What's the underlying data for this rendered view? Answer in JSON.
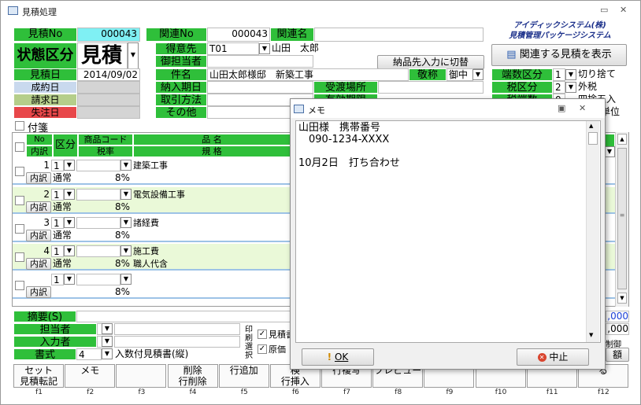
{
  "window": {
    "title": "見積処理",
    "minimize": "▭",
    "close": "✕"
  },
  "company": {
    "line1": "アイディックシステム(株)",
    "line2": "見積管理パッケージシステム"
  },
  "header": {
    "mitsumori_no_label": "見積No",
    "mitsumori_no": "000043",
    "kanren_no_label": "関連No",
    "kanren_no": "000043",
    "kanren_mei_label": "関連名"
  },
  "status": {
    "label": "状態区分",
    "value": "見積"
  },
  "dates": {
    "mitsumori_label": "見積日",
    "mitsumori_value": "2014/09/02",
    "seiyaku_label": "成約日",
    "seikyu_label": "請求日",
    "shitchu_label": "失注日"
  },
  "customer": {
    "tokuisaki_label": "得意先",
    "tokuisaki_code": "T01",
    "tokuisaki_name": "山田　太郎",
    "tantosha_label": "御担当者",
    "kenmei_label": "件名",
    "kenmei": "山田太郎様邸　新築工事",
    "keisho_label": "敬称",
    "keisho": "御中",
    "nonyu_label": "納入期日",
    "uketori_label": "受渡場所",
    "torihiki_label": "取引方法",
    "sonota_label": "その他",
    "hidden_label": "有効期限"
  },
  "buttons": {
    "nohin": "納品先入力に切替",
    "kanren_show": "関連する見積を表示"
  },
  "right_panel": {
    "hasu_label": "端数区分",
    "hasu_code": "1",
    "hasu_value": "切り捨て",
    "zei_label": "税区分",
    "zei_code": "2",
    "zei_value": "外税",
    "zei_hasu_label": "税端数",
    "zei_hasu_code": "0",
    "zei_hasu_value": "四捨五入",
    "tani_value": "単位"
  },
  "fusen": {
    "label": "付箋"
  },
  "grid": {
    "h_no": "No",
    "h_kubun": "区分",
    "h_code": "商品コード",
    "h_hinmei": "品 名",
    "h_uchiwake": "内訳",
    "h_zeiritsu": "税率",
    "h_kikaku": "規 格",
    "rows": [
      {
        "no": "1",
        "kubun": "1",
        "name": "建築工事",
        "uchiwake": "内訳",
        "tsujo": "通常",
        "rate": "8%",
        "kikaku": ""
      },
      {
        "no": "2",
        "kubun": "1",
        "name": "電気設備工事",
        "uchiwake": "内訳",
        "tsujo": "通常",
        "rate": "8%",
        "kikaku": ""
      },
      {
        "no": "3",
        "kubun": "1",
        "name": "諸経費",
        "uchiwake": "内訳",
        "tsujo": "通常",
        "rate": "8%",
        "kikaku": ""
      },
      {
        "no": "4",
        "kubun": "1",
        "name": "施工費",
        "uchiwake": "内訳",
        "tsujo": "通常",
        "rate": "8%",
        "kikaku": "職人代含"
      },
      {
        "no": "",
        "kubun": "1",
        "name": "",
        "uchiwake": "内訳",
        "tsujo": "",
        "rate": "8%",
        "kikaku": ""
      }
    ]
  },
  "bottom": {
    "tekiyo_label": "摘要(S)",
    "tanto_label": "担当者",
    "nyuryoku_label": "入力者",
    "shoshiki_label": "書式",
    "shoshiki_code": "4",
    "shoshiki_value": "入数付見積書(縦)",
    "insatsu_label": "印刷選択",
    "opt1": "見積書",
    "opt2": "原価",
    "val1": ",000",
    "val2": ",000",
    "seigyo": "制御",
    "gaku": "額"
  },
  "fkeys": [
    {
      "top": "セット",
      "bottom": "見積転記",
      "num": "f1"
    },
    {
      "top": "",
      "bottom": "メモ",
      "num": "f2"
    },
    {
      "top": "",
      "bottom": "",
      "num": "f3"
    },
    {
      "top": "削除",
      "bottom": "行削除",
      "num": "f4"
    },
    {
      "top": "",
      "bottom": "行追加",
      "num": "f5"
    },
    {
      "top": "検",
      "bottom": "行挿入",
      "num": "f6"
    },
    {
      "top": "",
      "bottom": "行複写",
      "num": "f7"
    },
    {
      "top": "",
      "bottom": "プレビュー",
      "num": "f8"
    },
    {
      "top": "",
      "bottom": "",
      "num": "f9"
    },
    {
      "top": "",
      "bottom": "",
      "num": "f10"
    },
    {
      "top": "",
      "bottom": "",
      "num": "f11"
    },
    {
      "top": "る",
      "bottom": "",
      "num": "f12"
    }
  ],
  "memo": {
    "title": "メモ",
    "line1": "山田様　携帯番号",
    "line2": "　090-1234-XXXX",
    "line3": "",
    "line4": "10月2日　打ち合わせ",
    "ok": "OK",
    "cancel": "中止"
  }
}
